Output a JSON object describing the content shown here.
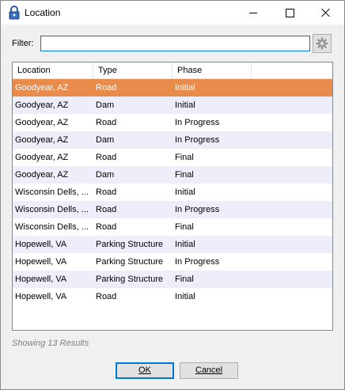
{
  "window": {
    "title": "Location",
    "icon": "lock-icon"
  },
  "filter": {
    "label": "Filter:",
    "value": "",
    "settings_icon": "gear-icon"
  },
  "table": {
    "columns": [
      "Location",
      "Type",
      "Phase"
    ],
    "rows": [
      {
        "location": "Goodyear, AZ",
        "type": "Road",
        "phase": "Initial"
      },
      {
        "location": "Goodyear, AZ",
        "type": "Dam",
        "phase": "Initial"
      },
      {
        "location": "Goodyear, AZ",
        "type": "Road",
        "phase": "In Progress"
      },
      {
        "location": "Goodyear, AZ",
        "type": "Dam",
        "phase": "In Progress"
      },
      {
        "location": "Goodyear, AZ",
        "type": "Road",
        "phase": "Final"
      },
      {
        "location": "Goodyear, AZ",
        "type": "Dam",
        "phase": "Final"
      },
      {
        "location": "Wisconsin Dells, ...",
        "type": "Road",
        "phase": "Initial"
      },
      {
        "location": "Wisconsin Dells, ...",
        "type": "Road",
        "phase": "In Progress"
      },
      {
        "location": "Wisconsin Dells, ...",
        "type": "Road",
        "phase": "Final"
      },
      {
        "location": "Hopewell, VA",
        "type": "Parking Structure",
        "phase": "Initial"
      },
      {
        "location": "Hopewell, VA",
        "type": "Parking Structure",
        "phase": "In Progress"
      },
      {
        "location": "Hopewell, VA",
        "type": "Parking Structure",
        "phase": "Final"
      },
      {
        "location": "Hopewell, VA",
        "type": "Road",
        "phase": "Initial"
      }
    ],
    "selected_index": 0,
    "colors": {
      "selected": "#e88b4b",
      "alt_row": "#eeeefa"
    }
  },
  "status": {
    "results_text": "Showing 13 Results"
  },
  "buttons": {
    "ok": "OK",
    "cancel": "Cancel"
  }
}
